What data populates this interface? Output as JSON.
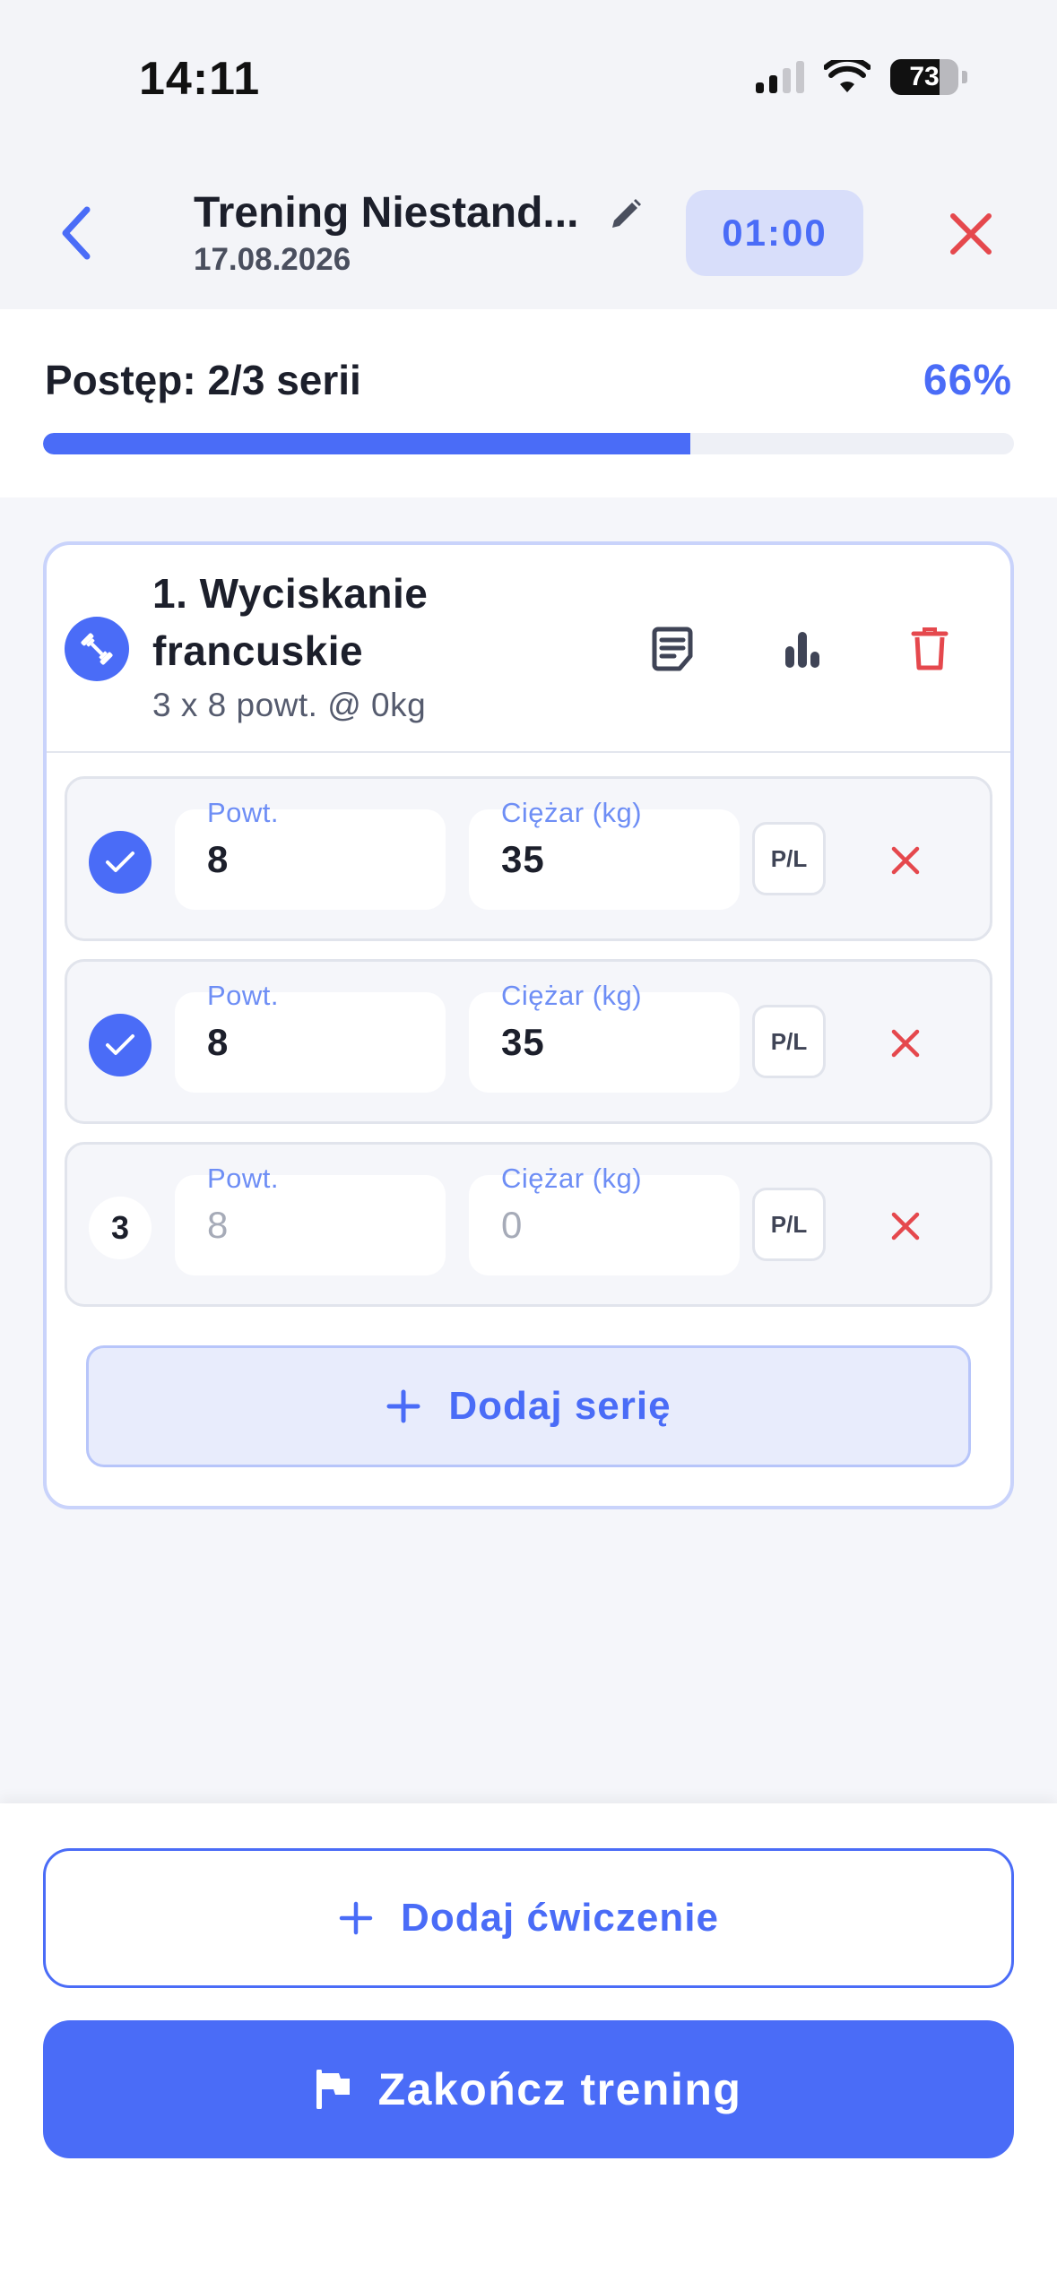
{
  "status_bar": {
    "time": "14:11",
    "battery": "73"
  },
  "header": {
    "title": "Trening Niestand...",
    "date": "17.08.2026",
    "timer": "01:00"
  },
  "progress": {
    "label": "Postęp: 2/3 serii",
    "percent_text": "66%",
    "fraction": 0.667
  },
  "exercise": {
    "title": "1. Wyciskanie francuskie",
    "subtitle": "3 x 8 powt. @ 0kg",
    "sets": [
      {
        "status": "done",
        "badge": "",
        "reps_label": "Powt.",
        "reps": "8",
        "weight_label": "Ciężar (kg)",
        "weight": "35",
        "side_label": "P/L"
      },
      {
        "status": "done",
        "badge": "",
        "reps_label": "Powt.",
        "reps": "8",
        "weight_label": "Ciężar (kg)",
        "weight": "35",
        "side_label": "P/L"
      },
      {
        "status": "todo",
        "badge": "3",
        "reps_label": "Powt.",
        "reps_placeholder": "8",
        "weight_label": "Ciężar (kg)",
        "weight_placeholder": "0",
        "side_label": "P/L"
      }
    ],
    "add_set_label": "Dodaj serię"
  },
  "actions": {
    "add_exercise_label": "Dodaj ćwiczenie",
    "finish_label": "Zakończ trening"
  },
  "colors": {
    "accent": "#4a6cf7",
    "danger": "#e5484d",
    "accent_light": "#d8defa"
  },
  "icons": [
    "back-chevron-icon",
    "pencil-icon",
    "close-icon",
    "dumbbell-icon",
    "notes-icon",
    "stats-icon",
    "trash-icon",
    "check-icon",
    "delete-x-icon",
    "plus-icon",
    "flag-icon"
  ]
}
